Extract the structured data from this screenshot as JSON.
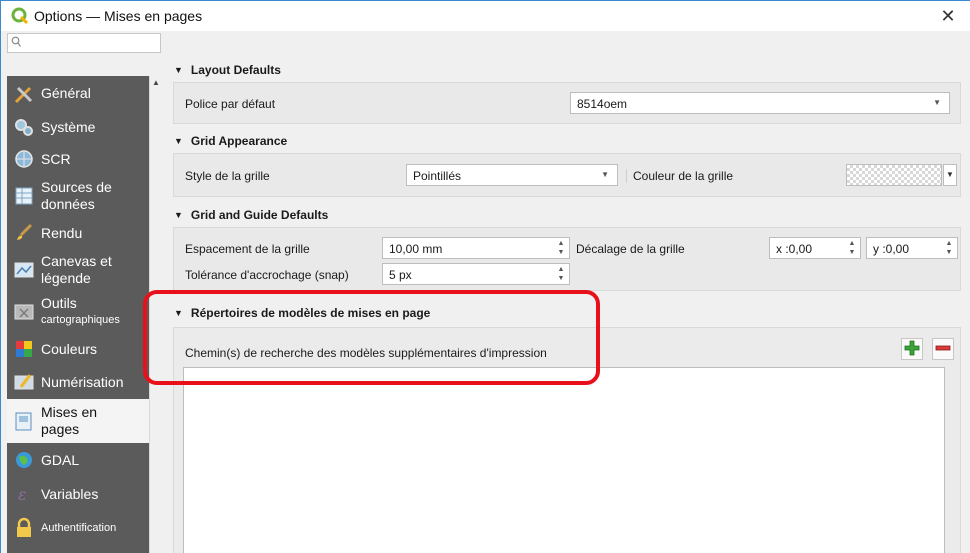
{
  "window": {
    "title": "Options — Mises en pages",
    "close_glyph": "✕"
  },
  "sidebar": {
    "search_placeholder": "",
    "items": [
      {
        "label": "Général",
        "icon": "tools-icon"
      },
      {
        "label": "Système",
        "icon": "gears-icon"
      },
      {
        "label": "SCR",
        "icon": "globe-icon"
      },
      {
        "label": "Sources de données",
        "icon": "table-icon"
      },
      {
        "label": "Rendu",
        "icon": "brush-icon"
      },
      {
        "label": "Canevas et légende",
        "icon": "map-canvas-icon"
      },
      {
        "label": "Outils",
        "sub": "cartographiques",
        "icon": "map-tools-icon"
      },
      {
        "label": "Couleurs",
        "icon": "palette-icon"
      },
      {
        "label": "Numérisation",
        "icon": "digitize-icon"
      },
      {
        "label": "Mises en pages",
        "icon": "layout-icon",
        "active": true
      },
      {
        "label": "GDAL",
        "icon": "gdal-icon"
      },
      {
        "label": "Variables",
        "icon": "variables-icon"
      },
      {
        "label": "Authentification",
        "icon": "lock-icon"
      }
    ]
  },
  "layout_defaults": {
    "header": "Layout Defaults",
    "font_label": "Police par défaut",
    "font_value": "8514oem"
  },
  "grid_appearance": {
    "header": "Grid Appearance",
    "style_label": "Style de la grille",
    "style_value": "Pointillés",
    "color_label": "Couleur de la grille"
  },
  "grid_guide_defaults": {
    "header": "Grid and Guide Defaults",
    "spacing_label": "Espacement de la grille",
    "spacing_value": "10,00 mm",
    "offset_label": "Décalage de la grille",
    "offset_x": "x :0,00",
    "offset_y": "y :0,00",
    "snap_label": "Tolérance d'accrochage (snap)",
    "snap_value": "5 px"
  },
  "templates": {
    "header": "Répertoires de modèles de mises en page",
    "paths_label": "Chemin(s) de recherche des modèles supplémentaires d'impression"
  },
  "colors": {
    "sidebar_bg": "#5b5b5b",
    "highlight": "#e8101a",
    "add_green": "#3aa33a",
    "remove_red": "#d93a3a"
  }
}
